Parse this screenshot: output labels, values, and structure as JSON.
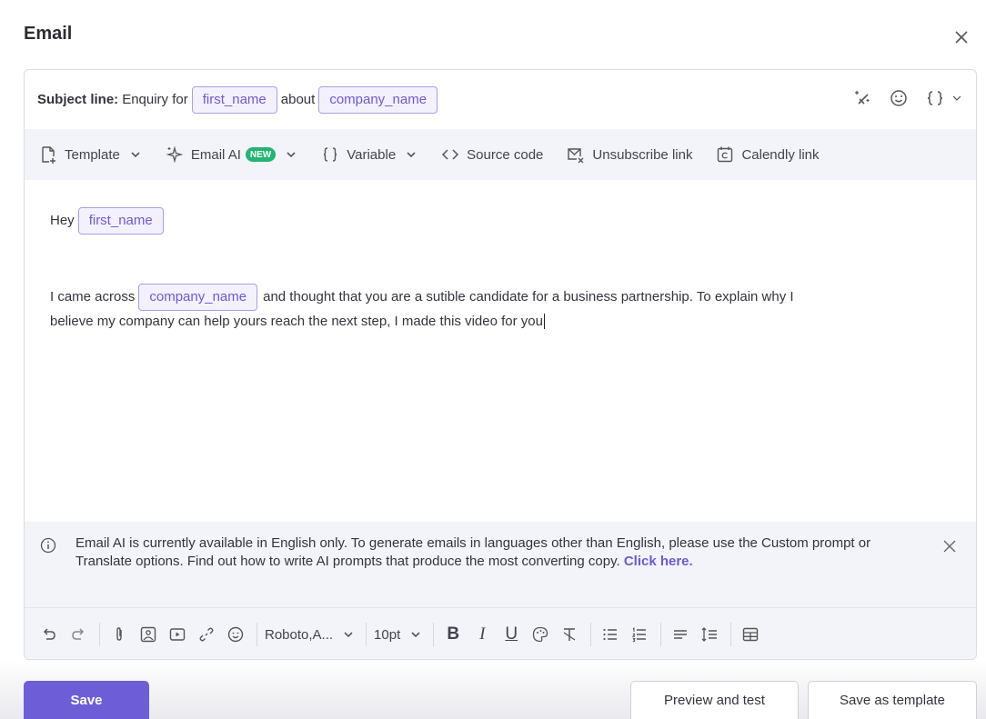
{
  "dialog": {
    "title": "Email"
  },
  "subject": {
    "label": "Subject line:",
    "text_before": "Enquiry for",
    "var1": "first_name",
    "text_middle": "about",
    "var2": "company_name"
  },
  "subject_tools": {
    "icons": [
      "magic-wand-icon",
      "emoji-icon",
      "braces-icon",
      "chevron-down-icon"
    ]
  },
  "toolbar": {
    "template": "Template",
    "email_ai": "Email AI",
    "new_badge": "NEW",
    "variable": "Variable",
    "source_code": "Source code",
    "unsubscribe": "Unsubscribe link",
    "calendly": "Calendly link"
  },
  "body": {
    "greeting": "Hey",
    "greeting_var": "first_name",
    "line1_before": "I came across",
    "line1_var": "company_name",
    "line1_after": "and thought that you are a sutible candidate for a business partnership. To explain why I",
    "line2": "believe my company can help yours reach the next step, I made this video for you"
  },
  "banner": {
    "text": "Email AI is currently available in English only. To generate emails in languages other than English, please use the Custom prompt or Translate options. Find out how to write AI prompts that produce the most converting copy.",
    "link": "Click here."
  },
  "format_toolbar": {
    "font": "Roboto,A...",
    "size": "10pt",
    "bold": "B",
    "italic": "I",
    "underline": "U"
  },
  "footer": {
    "save": "Save",
    "preview": "Preview and test",
    "save_template": "Save as template"
  },
  "colors": {
    "accent": "#6d5ed8",
    "chip_border": "#a99ee6",
    "chip_bg": "#f4f1ff",
    "toolbar_bg": "#f3f4f9",
    "badge_green": "#22b573"
  }
}
